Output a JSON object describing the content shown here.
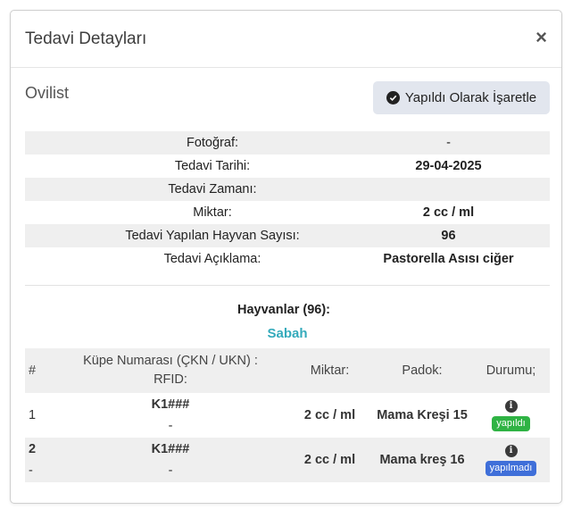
{
  "modal": {
    "title": "Tedavi Detayları",
    "close_label": "×"
  },
  "section": {
    "title": "Ovilist",
    "mark_done_label": "Yapıldı Olarak İşaretle"
  },
  "details": [
    {
      "label": "Fotoğraf:",
      "value": "-"
    },
    {
      "label": "Tedavi Tarihi:",
      "value": "29-04-2025"
    },
    {
      "label": "Tedavi Zamanı:",
      "value": ""
    },
    {
      "label": "Miktar:",
      "value": "2 cc / ml"
    },
    {
      "label": "Tedavi Yapılan Hayvan Sayısı:",
      "value": "96"
    },
    {
      "label": "Tedavi Açıklama:",
      "value": "Pastorella Asısı ciğer"
    }
  ],
  "animals": {
    "title": "Hayvanlar (96):",
    "shift": "Sabah",
    "headers": {
      "index": "#",
      "tag_line1": "Küpe Numarası (ÇKN / UKN) :",
      "tag_line2": "RFID:",
      "amount": "Miktar:",
      "pen": "Padok:",
      "status": "Durumu;"
    },
    "rows": [
      {
        "index": "1",
        "index_sub": "",
        "tag": "K1###",
        "rfid": "-",
        "amount": "2 cc / ml",
        "pen": "Mama Kreşi 15",
        "status": "yapıldı",
        "status_color": "#2fb344"
      },
      {
        "index": "2",
        "index_sub": "-",
        "tag": "K1###",
        "rfid": "-",
        "amount": "2 cc / ml",
        "pen": "Mama kreş 16",
        "status": "yapılmadı",
        "status_color": "#3f6fd9"
      }
    ]
  },
  "icons": {
    "close": "close-icon",
    "check": "check-circle-icon",
    "info": "info-icon"
  }
}
